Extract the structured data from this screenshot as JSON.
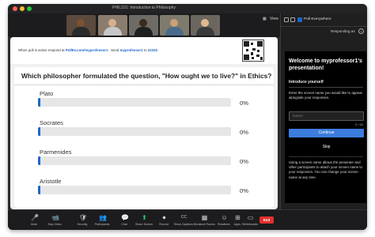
{
  "window": {
    "title": "PHIL101: Introduction to Philosophy"
  },
  "top_right": {
    "view_label": "View"
  },
  "poll_header": {
    "instruction_prefix": "When poll is active respond at",
    "url": "PollEv.com/myprofessor1",
    "send_prefix": "Send",
    "send_code": "myprofessor1",
    "send_to": "to",
    "send_number": "22333"
  },
  "poll": {
    "question": "Which philosopher formulated the question, \"How ought we to live?\" in Ethics?",
    "options": [
      {
        "label": "Plato",
        "percent": "0%"
      },
      {
        "label": "Socrates",
        "percent": "0%"
      },
      {
        "label": "Parmenides",
        "percent": "0%"
      },
      {
        "label": "Aristotle",
        "percent": "0%"
      }
    ]
  },
  "sidebar": {
    "app_title": "Poll Everywhere",
    "responding_as": "Responding as",
    "close_glyph": "×",
    "welcome_title": "Welcome to myprofessor1's presentation!",
    "intro_heading": "Introduce yourself",
    "intro_desc": "Enter the screen name you would like to appear alongside your responses.",
    "name_placeholder": "Name",
    "name_counter": "0 / 50",
    "continue_label": "Continue",
    "skip_label": "Skip",
    "note": "Using a screen name allows the presenter and other participants to attach your screen name to your responses. You can change your screen name at any time."
  },
  "toolbar": {
    "items": [
      {
        "label": "Mute",
        "icon": "microphone-icon",
        "glyph": "🎤"
      },
      {
        "label": "Stop Video",
        "icon": "video-camera-icon",
        "glyph": "📹"
      },
      {
        "label": "Security",
        "icon": "shield-icon",
        "glyph": "🛡"
      },
      {
        "label": "Participants",
        "icon": "participants-icon",
        "glyph": "👥"
      },
      {
        "label": "Chat",
        "icon": "chat-icon",
        "glyph": "💬"
      },
      {
        "label": "Share Screen",
        "icon": "share-screen-icon",
        "glyph": "⬆"
      },
      {
        "label": "Record",
        "icon": "record-icon",
        "glyph": "⏺"
      },
      {
        "label": "Show Captions",
        "icon": "captions-icon",
        "glyph": "CC"
      },
      {
        "label": "Breakout Rooms",
        "icon": "breakout-icon",
        "glyph": "▦"
      },
      {
        "label": "Reactions",
        "icon": "reactions-icon",
        "glyph": "☺"
      },
      {
        "label": "Apps",
        "icon": "apps-icon",
        "glyph": "⊞"
      },
      {
        "label": "Whiteboards",
        "icon": "whiteboard-icon",
        "glyph": "▭"
      }
    ],
    "end_label": "End"
  },
  "colors": {
    "brand_blue": "#1b66c9",
    "continue_blue": "#3d7ddd",
    "end_red": "#e0302e",
    "share_green": "#2ecc71"
  }
}
